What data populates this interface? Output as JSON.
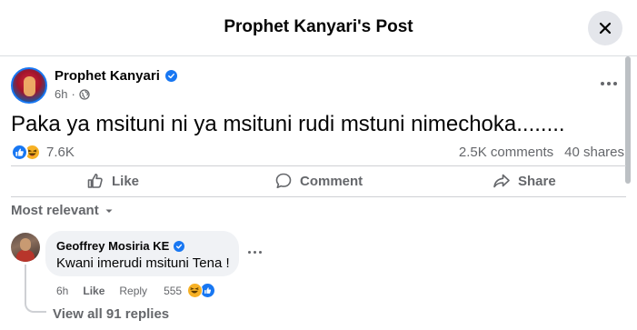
{
  "header": {
    "title": "Prophet Kanyari's Post"
  },
  "post": {
    "author": "Prophet Kanyari",
    "time": "6h",
    "text": "Paka ya msituni ni ya msituni rudi mstuni nimechoka........",
    "reactions_count": "7.6K",
    "comments_count": "2.5K comments",
    "shares_count": "40 shares"
  },
  "actions": {
    "like": "Like",
    "comment": "Comment",
    "share": "Share"
  },
  "comments_sort": {
    "label": "Most relevant"
  },
  "comment": {
    "author": "Geoffrey Mosiria KE",
    "text": "Kwani imerudi msituni Tena !",
    "time": "6h",
    "like_label": "Like",
    "reply_label": "Reply",
    "reactions_count": "555",
    "view_replies": "View all 91 replies"
  },
  "colors": {
    "accent": "#1877f2",
    "muted": "#65676b",
    "surface": "#f0f2f5"
  }
}
